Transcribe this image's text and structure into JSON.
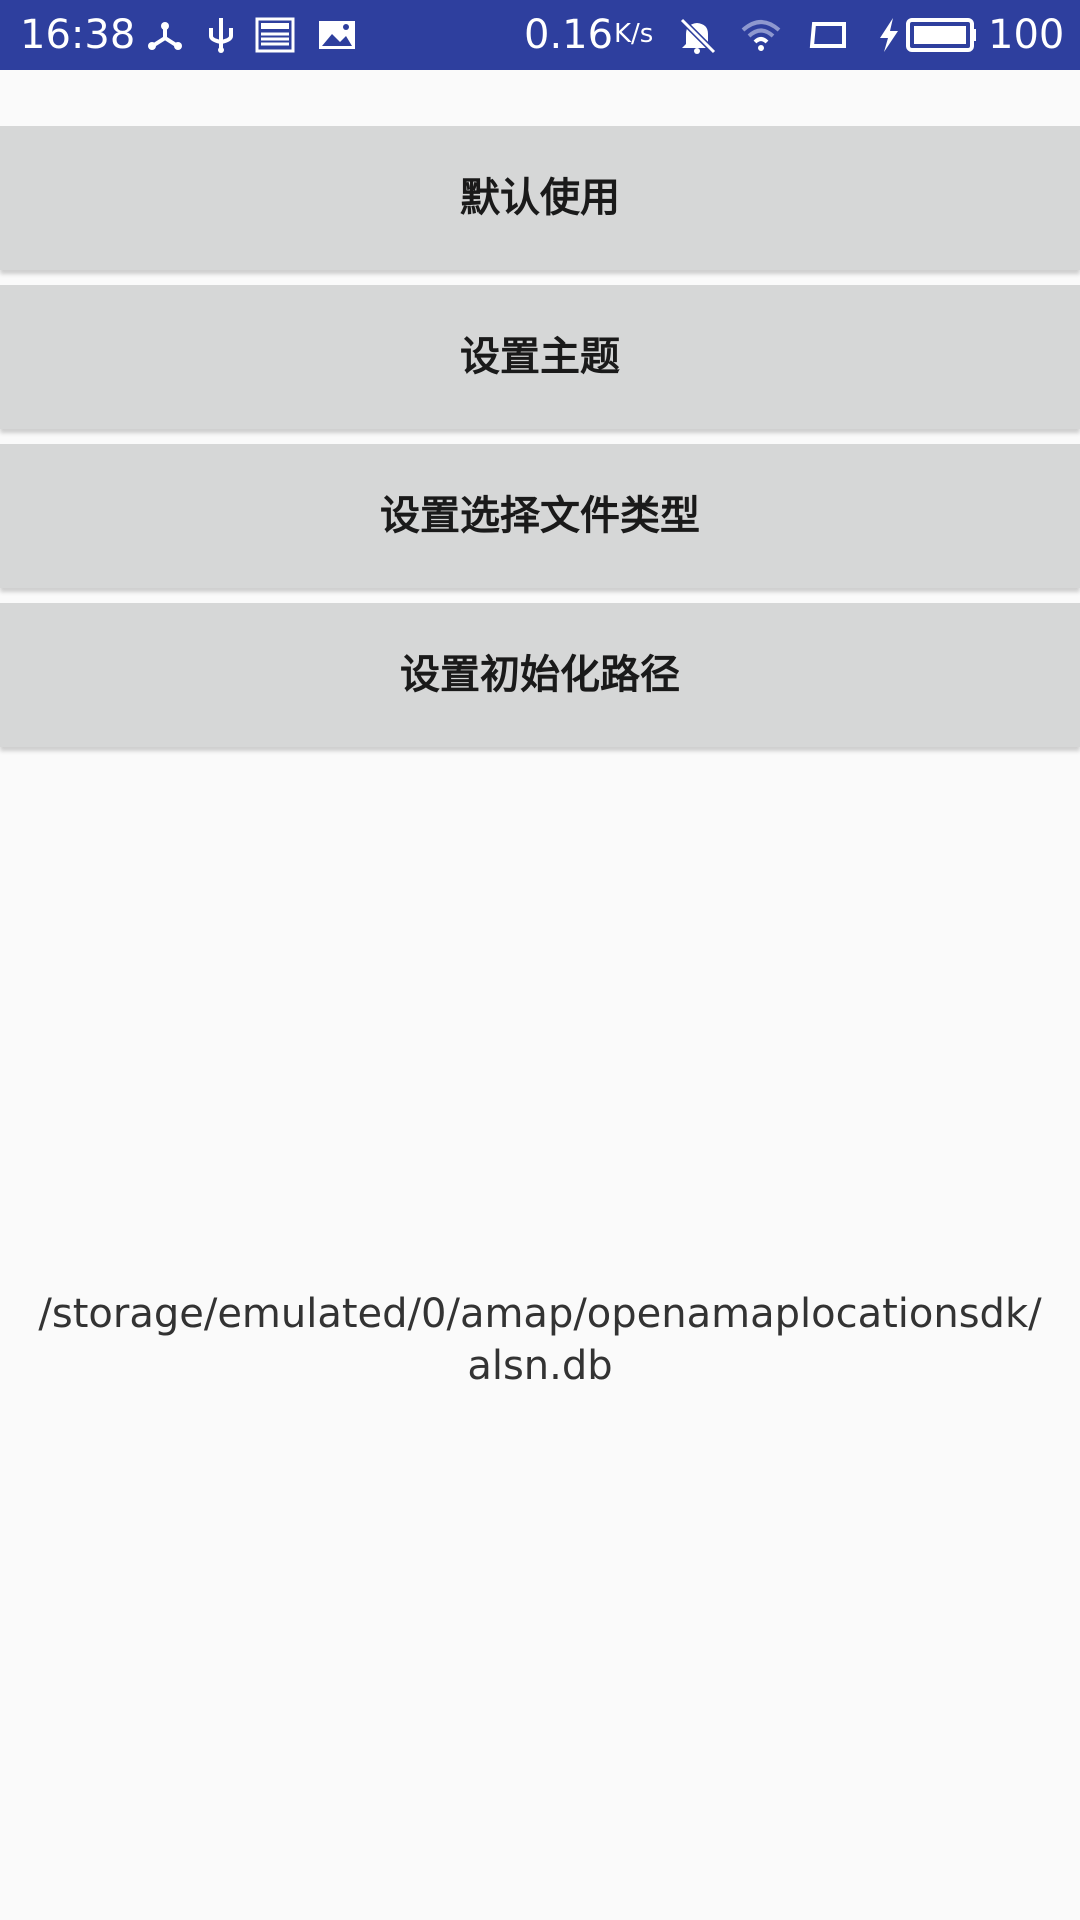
{
  "status_bar": {
    "time": "16:38",
    "net_speed": "0.16",
    "net_speed_unit": "K/s",
    "battery": "100",
    "icons": [
      "share-icon",
      "usb-icon",
      "news-icon",
      "image-icon",
      "mute-icon",
      "wifi-icon",
      "screen-icon",
      "charging-icon",
      "battery-icon"
    ],
    "color": "#2e3f9e"
  },
  "buttons": {
    "default_use": "默认使用",
    "set_theme": "设置主题",
    "set_file_type": "设置选择文件类型",
    "set_init_path": "设置初始化路径"
  },
  "result": {
    "path_line1": "/storage/emulated/0/amap/openamaplocationsdk/",
    "path_line2": "alsn.db"
  }
}
